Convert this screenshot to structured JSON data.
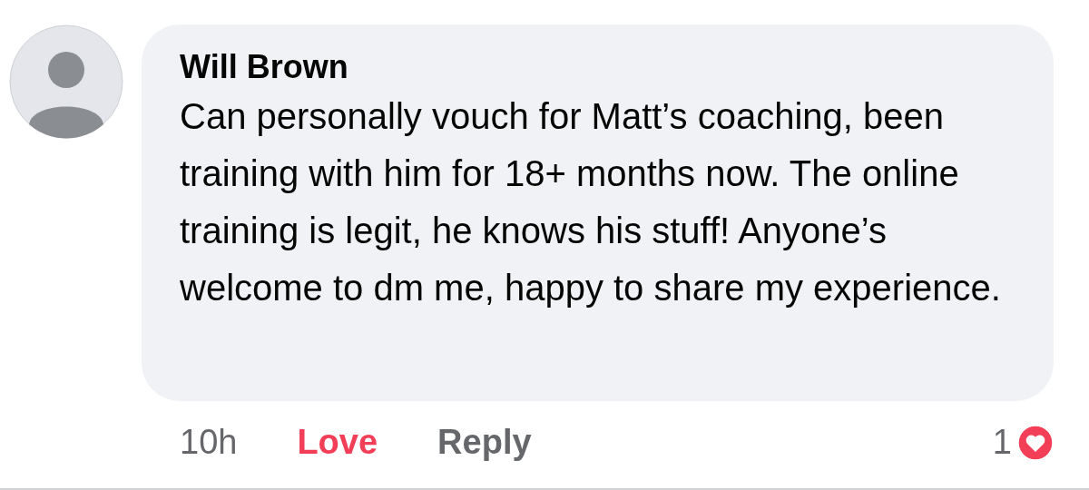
{
  "comment": {
    "author": "Will Brown",
    "text": "Can personally vouch for Matt’s coaching, been training with him for 18+ months now. The online training is legit, he knows his stuff! Anyone’s welcome to dm me, happy to share my experience.",
    "time": "10h",
    "actions": [
      {
        "label": "Love",
        "selected": true
      },
      {
        "label": "Reply",
        "selected": false
      }
    ],
    "reaction_count": "1"
  }
}
